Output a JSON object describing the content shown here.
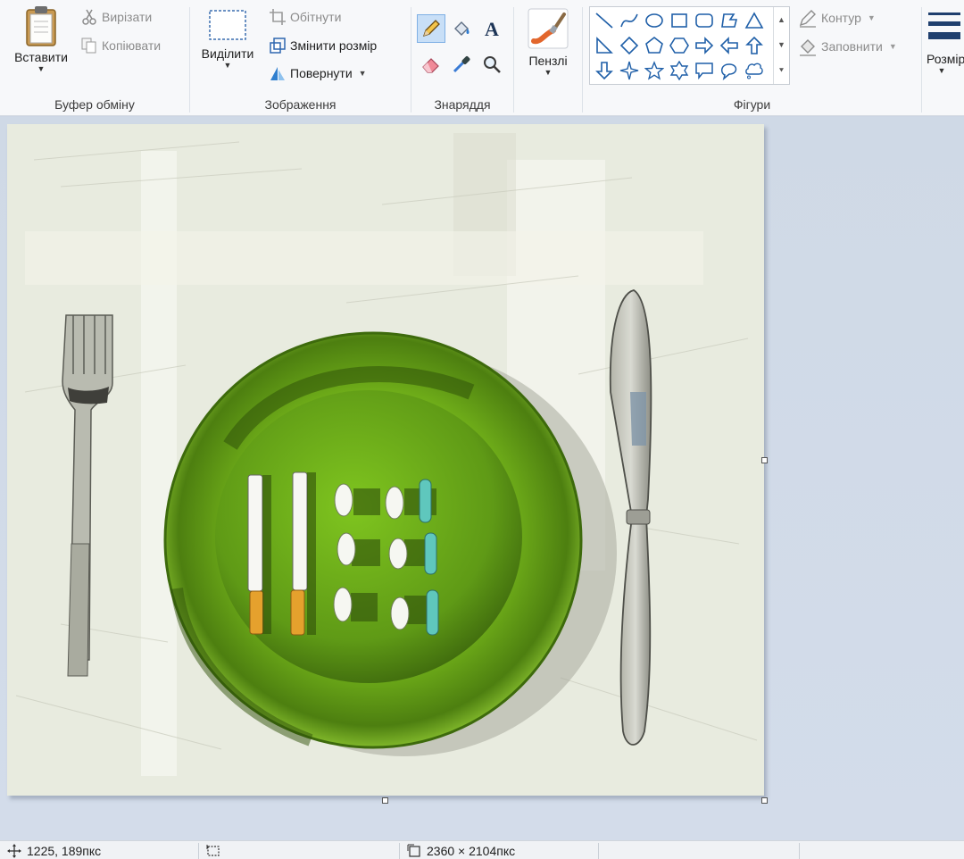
{
  "ribbon": {
    "clipboard": {
      "label": "Буфер обміну",
      "paste": "Вставити",
      "cut": "Вирізати",
      "copy": "Копіювати"
    },
    "image": {
      "label": "Зображення",
      "select": "Виділити",
      "crop": "Обітнути",
      "resize": "Змінити розмір",
      "rotate": "Повернути"
    },
    "tools": {
      "label": "Знаряддя",
      "items": [
        "pencil-icon",
        "fill-icon",
        "text-icon",
        "eraser-icon",
        "color-picker-icon",
        "magnifier-icon"
      ],
      "selected": "pencil-icon"
    },
    "brushes": {
      "label": "Пензлі"
    },
    "shapes": {
      "label": "Фігури",
      "outline": "Контур",
      "fill": "Заповнити"
    },
    "size": {
      "label": "Розмір"
    }
  },
  "status": {
    "cursor_position": "1225, 189пкс",
    "selection_size": "",
    "image_size": "2360 × 2104пкс"
  },
  "colors": {
    "plate": "#7dbf1e",
    "plate_dark": "#3f6b10",
    "canvas_bg": "#eceee4",
    "ribbon_bg": "#f7f8fa",
    "workspace_bg": "#cfd9e6"
  }
}
